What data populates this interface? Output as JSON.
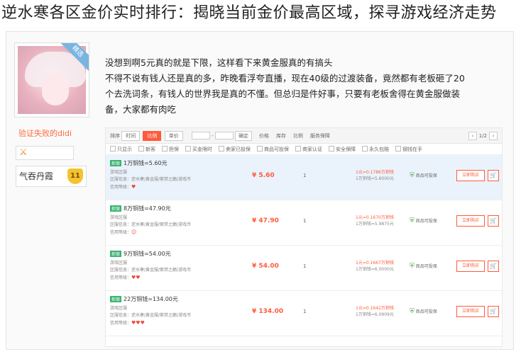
{
  "headline": "逆水寒各区金价实时排行：揭晓当前金价最高区域，探寻游戏经济走势",
  "profile": {
    "corner_label": "精选",
    "user_name": "验证失败的didi",
    "badge_icon": "fighter-icon",
    "nickname": "气吞丹霞",
    "level": "11"
  },
  "post": {
    "lines": [
      "没想到啊5元真的就是下限，这样看下来黄金服真的有搞头",
      "不得不说有钱人还是真的多，昨晚看浮夸直播，现在40级的过渡装备，竟然都有老板砸了20",
      "个去洗词条，有钱人的世界我是真的不懂。但总归是件好事，只要有老板舍得在黄金服做装",
      "备，大家都有肉吃"
    ]
  },
  "filters": {
    "sort_label": "排序",
    "sort_options": [
      "时间",
      "比例",
      "单价"
    ],
    "sort_active": "比例",
    "range_sep": "-",
    "confirm": "确定",
    "col_price": "价格",
    "col_stock": "库存",
    "col_ratio": "比例",
    "col_guard": "服务保障",
    "page_indicator": "1/2",
    "checkbox_options": [
      "只显示",
      "新客",
      "担保",
      "买金限时",
      "卖家已投保",
      "商品可投保",
      "商家认证",
      "安全保障",
      "永久包赔",
      "钢钱在手"
    ]
  },
  "listings": [
    {
      "tag": "担保",
      "title": "1万铜钱=5.60元",
      "meta": [
        "游戏区服",
        "区服信息：逆水寒/黄金服/紫禁之巅/游戏币",
        "信用等级："
      ],
      "hearts": "♥",
      "price": "¥ 5.60",
      "stock": "1",
      "ratio_main": "1元=0.1786万铜钱",
      "ratio_sub": "1万铜钱=5.6000元",
      "guard": "商品可投保",
      "buy": "立即购买",
      "highlight": true
    },
    {
      "tag": "担保",
      "title": "8万铜钱=47.90元",
      "meta": [
        "游戏区服",
        "区服信息：逆水寒/黄金服/紫禁之巅/游戏币",
        "信用等级："
      ],
      "hearts": "☺",
      "price": "¥ 47.90",
      "stock": "1",
      "ratio_main": "1元=0.1670万铜钱",
      "ratio_sub": "1万铜钱=5.9875元",
      "guard": "商品可投保",
      "buy": "立即购买",
      "highlight": false
    },
    {
      "tag": "担保",
      "title": "9万铜钱=54.00元",
      "meta": [
        "游戏区服",
        "区服信息：逆水寒/黄金服/紫禁之巅/游戏币",
        "信用等级："
      ],
      "hearts": "♥♥",
      "price": "¥ 54.00",
      "stock": "1",
      "ratio_main": "1元=0.1667万铜钱",
      "ratio_sub": "1万铜钱=6.0000元",
      "guard": "商品可投保",
      "buy": "立即购买",
      "highlight": false
    },
    {
      "tag": "担保",
      "title": "22万铜钱=134.00元",
      "meta": [
        "游戏区服",
        "区服信息：逆水寒/黄金服/紫禁之巅/游戏币",
        "信用等级："
      ],
      "hearts": "♥♥♥",
      "price": "¥ 134.00",
      "stock": "1",
      "ratio_main": "1元=0.1642万铜钱",
      "ratio_sub": "1万铜钱=6.0909元",
      "guard": "商品可投保",
      "buy": "立即购买",
      "highlight": false
    }
  ]
}
